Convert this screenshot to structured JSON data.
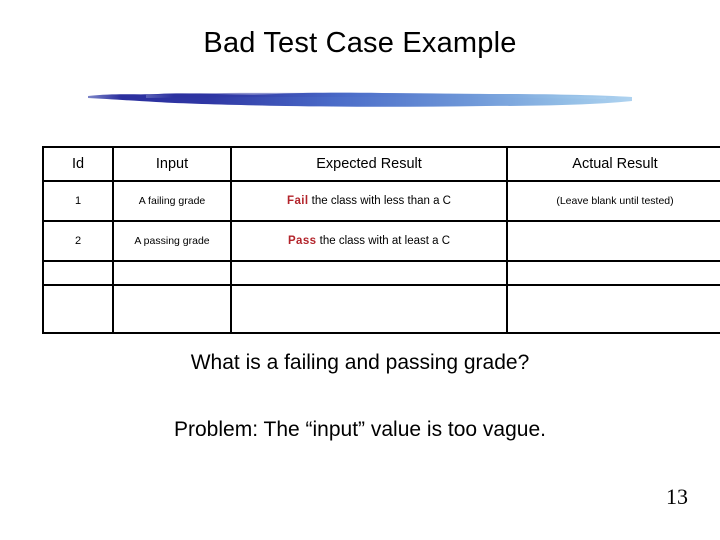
{
  "slide": {
    "title": "Bad Test Case Example",
    "page_number": "13",
    "accent_colors": {
      "brush_dark": "#2B2F9E",
      "brush_mid": "#4A6BC8",
      "brush_light": "#93BEE6",
      "keyword_red": "#B3242B"
    }
  },
  "table": {
    "headers": {
      "id": "Id",
      "input": "Input",
      "expected": "Expected Result",
      "actual": "Actual Result"
    },
    "rows": [
      {
        "id": "1",
        "input": "A failing grade",
        "expected_keyword": "Fail",
        "expected_rest": " the class with less than a C",
        "actual": "(Leave blank until tested)"
      },
      {
        "id": "2",
        "input": "A passing grade",
        "expected_keyword": "Pass",
        "expected_rest": " the class with at least a C",
        "actual": ""
      },
      {
        "id": "",
        "input": "",
        "expected_keyword": "",
        "expected_rest": "",
        "actual": ""
      },
      {
        "id": "",
        "input": "",
        "expected_keyword": "",
        "expected_rest": "",
        "actual": ""
      }
    ]
  },
  "body": {
    "line1": "What is a failing and passing grade?",
    "line2": "Problem: The “input” value is too vague."
  }
}
